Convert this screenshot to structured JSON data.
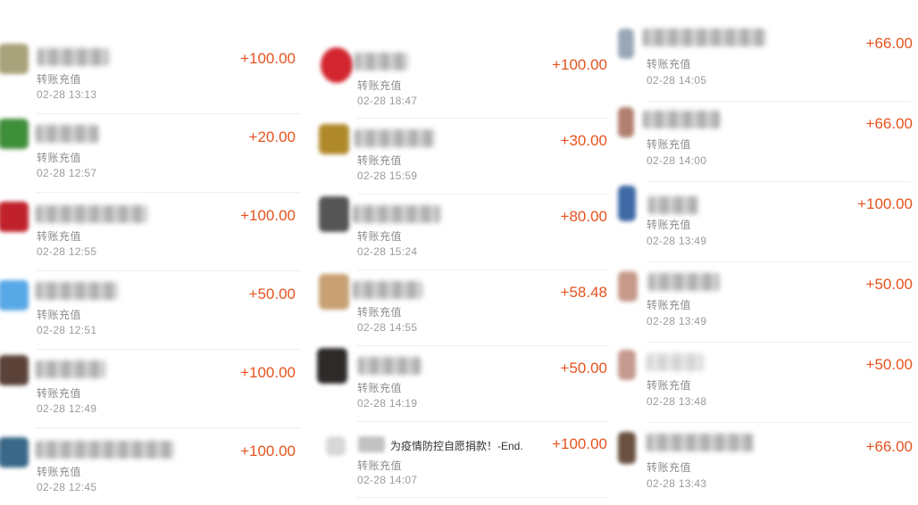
{
  "columns": [
    {
      "rows": [
        {
          "label": "转账充值",
          "time": "02-28 13:13",
          "amount": "+100.00",
          "avatar_color": "#a8a27a"
        },
        {
          "label": "转账充值",
          "time": "02-28 12:57",
          "amount": "+20.00",
          "avatar_color": "#3f8f3a"
        },
        {
          "label": "转账充值",
          "time": "02-28 12:55",
          "amount": "+100.00",
          "avatar_color": "#c0212b"
        },
        {
          "label": "转账充值",
          "time": "02-28 12:51",
          "amount": "+50.00",
          "avatar_color": "#58a8e6"
        },
        {
          "label": "转账充值",
          "time": "02-28 12:49",
          "amount": "+100.00",
          "avatar_color": "#5a4238"
        },
        {
          "label": "转账充值",
          "time": "02-28 12:45",
          "amount": "+100.00",
          "avatar_color": "#3a6888"
        }
      ]
    },
    {
      "rows": [
        {
          "label": "转账充值",
          "time": "02-28 18:47",
          "amount": "+100.00",
          "avatar_color": "#d22630"
        },
        {
          "label": "转账充值",
          "time": "02-28 15:59",
          "amount": "+30.00",
          "avatar_color": "#b08a2a"
        },
        {
          "label": "转账充值",
          "time": "02-28 15:24",
          "amount": "+80.00",
          "avatar_color": "#555555"
        },
        {
          "label": "转账充值",
          "time": "02-28 14:55",
          "amount": "+58.48",
          "avatar_color": "#c7a073"
        },
        {
          "label": "转账充值",
          "time": "02-28 14:19",
          "amount": "+50.00",
          "avatar_color": "#2f2a2a"
        },
        {
          "label": "转账充值",
          "time": "02-28 14:07",
          "amount": "+100.00",
          "avatar_color": "#d8d8d8",
          "note": "为疫情防控自愿捐款！-End."
        }
      ]
    },
    {
      "rows": [
        {
          "label": "转账充值",
          "time": "02-28 14:05",
          "amount": "+66.00",
          "avatar_color": "#98a8b6"
        },
        {
          "label": "转账充值",
          "time": "02-28 14:00",
          "amount": "+66.00",
          "avatar_color": "#b28070"
        },
        {
          "label": "转账充值",
          "time": "02-28 13:49",
          "amount": "+100.00",
          "avatar_color": "#3f6aa6"
        },
        {
          "label": "转账充值",
          "time": "02-28 13:49",
          "amount": "+50.00",
          "avatar_color": "#c69a8a"
        },
        {
          "label": "转账充值",
          "time": "02-28 13:48",
          "amount": "+50.00",
          "avatar_color": "#c59a90"
        },
        {
          "label": "转账充值",
          "time": "02-28 13:43",
          "amount": "+66.00",
          "avatar_color": "#6a5040"
        }
      ]
    }
  ]
}
